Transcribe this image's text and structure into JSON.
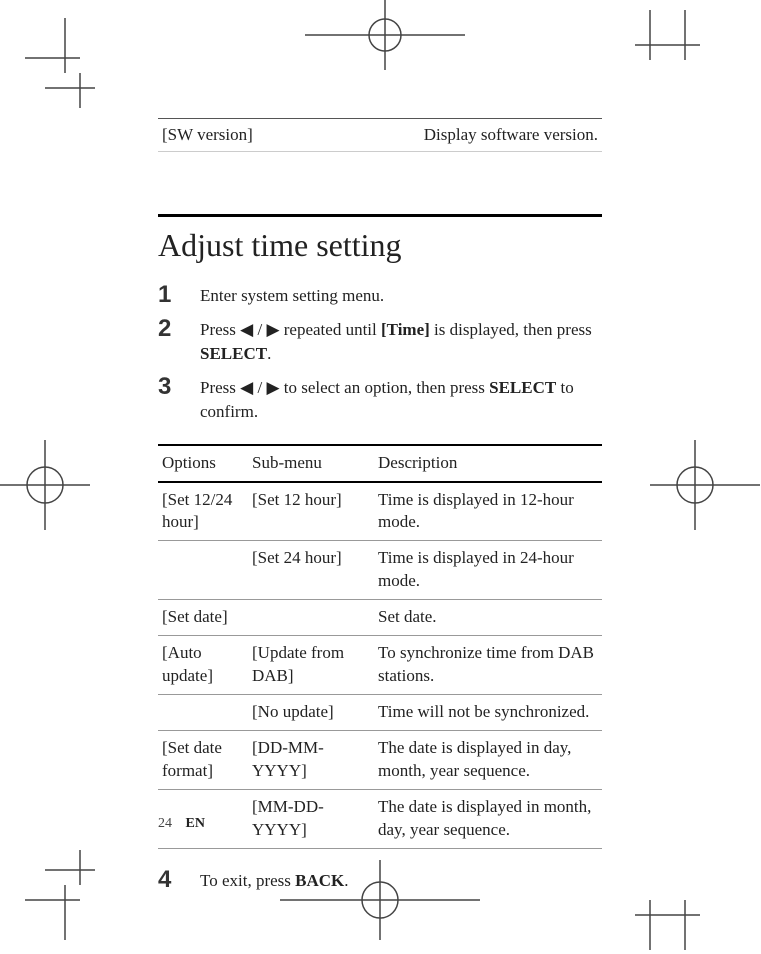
{
  "sw_row": {
    "left": "[SW version]",
    "right": "Display software version."
  },
  "section_title": "Adjust time setting",
  "steps": [
    {
      "num": "1",
      "body_html": "Enter system setting menu."
    },
    {
      "num": "2",
      "body_html": "Press ◀ / ▶ repeated until <b>[Time]</b> is displayed, then press <b>SELECT</b>."
    },
    {
      "num": "3",
      "body_html": "Press ◀ / ▶ to select an option, then press <b>SELECT</b> to confirm."
    }
  ],
  "table": {
    "headers": {
      "opt": "Options",
      "sub": "Sub-menu",
      "desc": "Description"
    },
    "rows": [
      {
        "opt": "[Set 12/24 hour]",
        "sub": "[Set 12 hour]",
        "desc": "Time is displayed in 12-hour mode."
      },
      {
        "opt": "",
        "sub": "[Set 24 hour]",
        "desc": "Time is displayed in 24-hour mode."
      },
      {
        "opt": "[Set date]",
        "sub": "",
        "desc": "Set date."
      },
      {
        "opt": "[Auto update]",
        "sub": "[Update from DAB]",
        "desc": "To synchronize time from DAB stations."
      },
      {
        "opt": "",
        "sub": "[No update]",
        "desc": "Time will not be synchronized."
      },
      {
        "opt": "[Set date format]",
        "sub": "[DD-MM-YYYY]",
        "desc": "The date is displayed in day, month, year sequence."
      },
      {
        "opt": "",
        "sub": "[MM-DD-YYYY]",
        "desc": "The date is displayed in month, day, year sequence."
      }
    ]
  },
  "step4": {
    "num": "4",
    "body_html": "To exit, press <b>BACK</b>."
  },
  "footer": {
    "page": "24",
    "lang": "EN"
  }
}
